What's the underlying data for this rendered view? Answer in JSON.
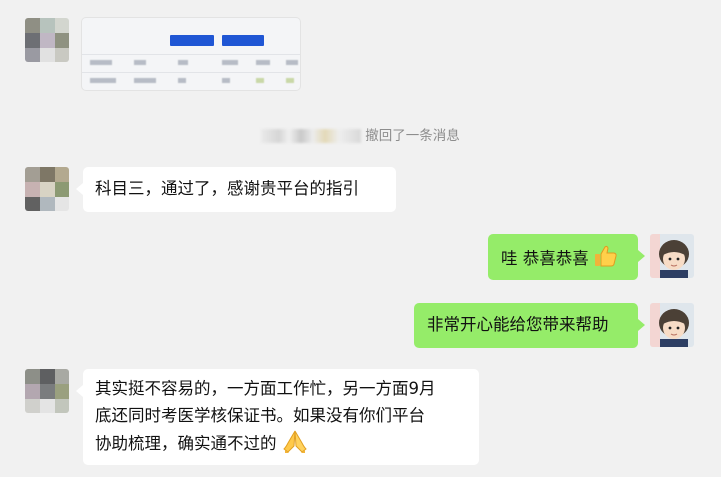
{
  "chat": {
    "recall_notice": {
      "text": "撤回了一条消息"
    },
    "messages": [
      {
        "side": "left",
        "text": "科目三，通过了，感谢贵平台的指引"
      },
      {
        "side": "right",
        "text": "哇 恭喜恭喜",
        "emoji": "thumbs-up"
      },
      {
        "side": "right",
        "text": "非常开心能给您带来帮助"
      },
      {
        "side": "left",
        "lines": [
          "其实挺不容易的，一方面工作忙，另一方面9月",
          "底还同时考医学核保证书。如果没有你们平台",
          "协助梳理，确实通不过的"
        ],
        "emoji": "praying-hands"
      }
    ]
  },
  "colors": {
    "background": "#f1f1f1",
    "incoming_bubble": "#ffffff",
    "outgoing_bubble": "#95ec69",
    "thumb_button": "#1f56d4"
  },
  "icons": [
    "thumbs-up-icon",
    "praying-hands-icon"
  ]
}
